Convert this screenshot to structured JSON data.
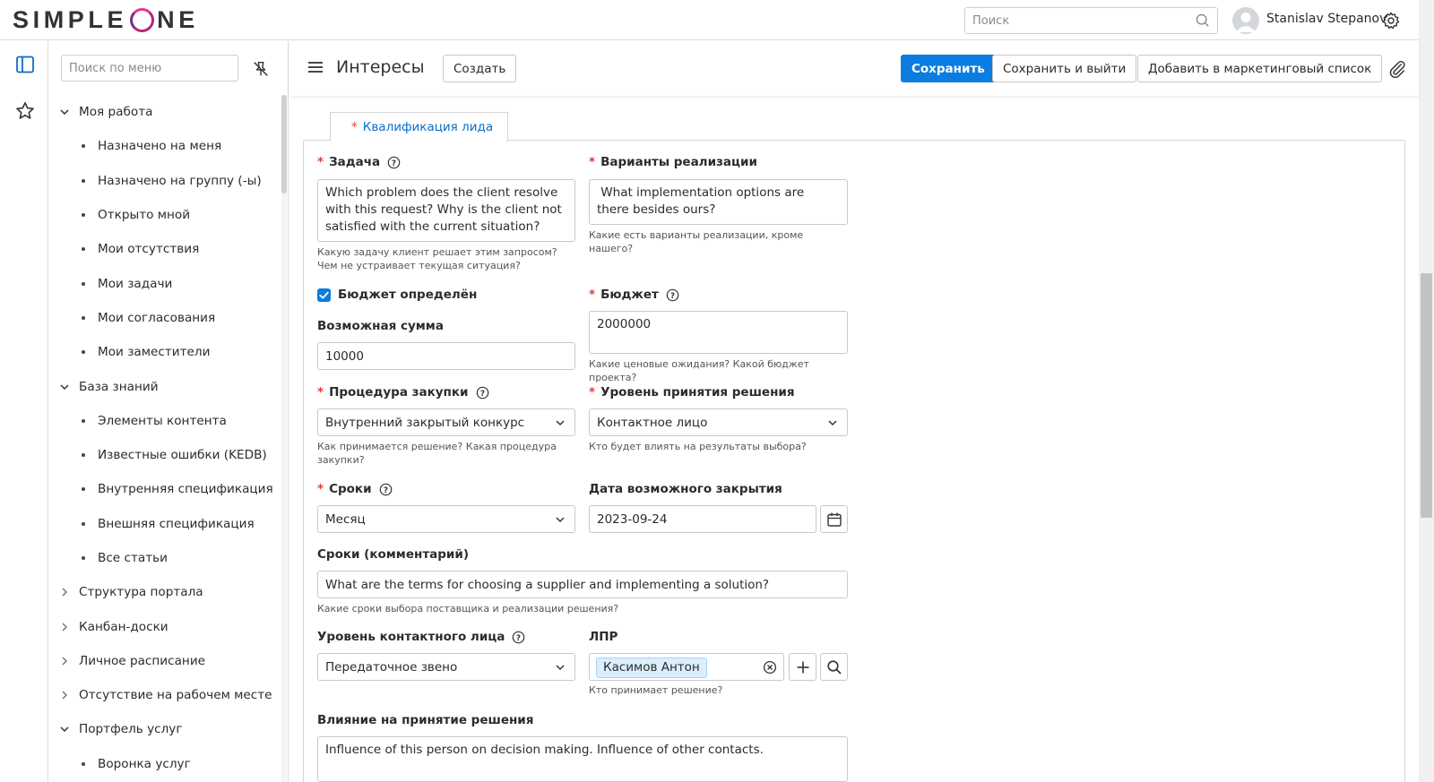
{
  "app": {
    "logo_text_left": "SIMPLE",
    "logo_text_right": "NE"
  },
  "topbar": {
    "search_placeholder": "Поиск",
    "user_name": "Stanislav Stepanov"
  },
  "sidebar": {
    "search_placeholder": "Поиск по меню",
    "items": [
      {
        "type": "group",
        "label": "Моя работа",
        "expanded": true
      },
      {
        "type": "child",
        "label": "Назначено на меня"
      },
      {
        "type": "child",
        "label": "Назначено на группу (-ы)"
      },
      {
        "type": "child",
        "label": "Открыто мной"
      },
      {
        "type": "child",
        "label": "Мои отсутствия"
      },
      {
        "type": "child",
        "label": "Мои задачи"
      },
      {
        "type": "child",
        "label": "Мои согласования"
      },
      {
        "type": "child",
        "label": "Мои заместители"
      },
      {
        "type": "group",
        "label": "База знаний",
        "expanded": true
      },
      {
        "type": "child",
        "label": "Элементы контента"
      },
      {
        "type": "child",
        "label": "Известные ошибки (KEDB)"
      },
      {
        "type": "child",
        "label": "Внутренняя спецификация"
      },
      {
        "type": "child",
        "label": "Внешняя спецификация"
      },
      {
        "type": "child",
        "label": "Все статьи"
      },
      {
        "type": "group",
        "label": "Структура портала",
        "expanded": false
      },
      {
        "type": "group",
        "label": "Канбан-доски",
        "expanded": false
      },
      {
        "type": "group",
        "label": "Личное расписание",
        "expanded": false
      },
      {
        "type": "group",
        "label": "Отсутствие на рабочем месте",
        "expanded": false
      },
      {
        "type": "group",
        "label": "Портфель услуг",
        "expanded": true
      },
      {
        "type": "child",
        "label": "Воронка услуг"
      }
    ]
  },
  "header": {
    "title": "Интересы",
    "create_label": "Создать",
    "save_label": "Сохранить",
    "save_exit_label": "Сохранить и выйти",
    "add_marketing_label": "Добавить в маркетинговый список"
  },
  "tab": {
    "label": "Квалификация лида"
  },
  "form": {
    "task": {
      "label": "Задача",
      "value": "Which problem does the client resolve with this request? Why is the client not satisfied with the current situation?",
      "hint": "Какую задачу клиент решает этим запросом? Чем не устраивает текущая ситуация?"
    },
    "options": {
      "label": "Варианты реализации",
      "value": " What implementation options are there besides ours?",
      "hint": "Какие есть варианты реализации, кроме нашего?"
    },
    "budget_defined": {
      "label": "Бюджет определён",
      "checked": true
    },
    "possible_sum": {
      "label": "Возможная сумма",
      "value": "10000"
    },
    "budget": {
      "label": "Бюджет",
      "value": "2000000",
      "hint": "Какие ценовые ожидания? Какой бюджет проекта?"
    },
    "procurement": {
      "label": "Процедура закупки",
      "value": "Внутренний закрытый конкурс",
      "hint": "Как принимается решение? Какая процедура закупки?"
    },
    "decision_level": {
      "label": "Уровень принятия решения",
      "value": "Контактное лицо",
      "hint": "Кто будет влиять на результаты выбора?"
    },
    "terms": {
      "label": "Сроки",
      "value": "Месяц"
    },
    "close_date": {
      "label": "Дата возможного закрытия",
      "value": "2023-09-24"
    },
    "terms_comment": {
      "label": "Сроки (комментарий)",
      "value": "What are the terms for choosing a supplier and implementing a solution?",
      "hint": "Какие сроки выбора поставщика и реализации решения?"
    },
    "contact_level": {
      "label": "Уровень контактного лица",
      "value": "Передаточное звено"
    },
    "lpr": {
      "label": "ЛПР",
      "tag": "Касимов Антон",
      "hint": "Кто принимает решение?"
    },
    "influence": {
      "label": "Влияние на принятие решения",
      "value": "Influence of this person on decision making. Influence of other contacts."
    }
  },
  "colors": {
    "primary": "#0b7de0",
    "required": "#e23a3a",
    "tab_text": "#0b6fc6",
    "tag_bg": "#dbeefc"
  }
}
